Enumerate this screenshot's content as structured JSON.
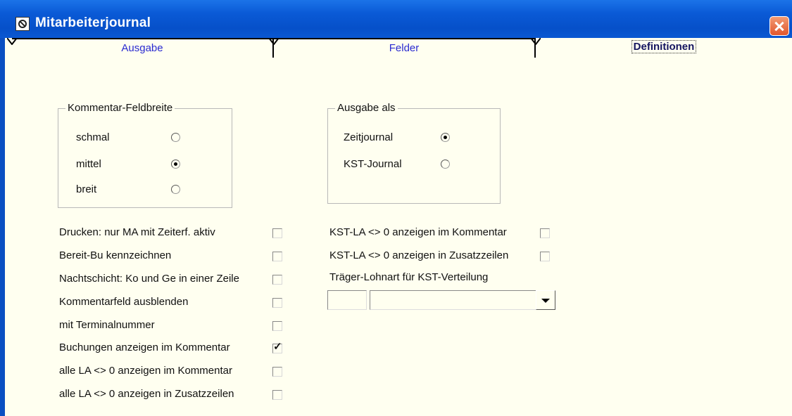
{
  "window": {
    "title": "Mitarbeiterjournal"
  },
  "tabs": [
    "Ausgabe",
    "Felder",
    "Definitionen"
  ],
  "kommentar_group": {
    "legend": "Kommentar-Feldbreite",
    "options": [
      {
        "label": "schmal",
        "selected": false
      },
      {
        "label": "mittel",
        "selected": true
      },
      {
        "label": "breit",
        "selected": false
      }
    ]
  },
  "ausgabe_group": {
    "legend": "Ausgabe als",
    "options": [
      {
        "label": "Zeitjournal",
        "selected": true
      },
      {
        "label": "KST-Journal",
        "selected": false
      }
    ]
  },
  "left_checks": [
    {
      "label": "Drucken: nur MA mit Zeiterf. aktiv",
      "checked": false
    },
    {
      "label": "Bereit-Bu kennzeichnen",
      "checked": false
    },
    {
      "label": "Nachtschicht: Ko und Ge in einer Zeile",
      "checked": false
    },
    {
      "label": "Kommentarfeld ausblenden",
      "checked": false
    },
    {
      "label": "mit Terminalnummer",
      "checked": false
    },
    {
      "label": "Buchungen anzeigen im Kommentar",
      "checked": true
    },
    {
      "label": "alle LA <> 0 anzeigen im Kommentar",
      "checked": false
    },
    {
      "label": "alle LA <> 0 anzeigen in Zusatzzeilen",
      "checked": false
    }
  ],
  "right_checks": [
    {
      "label": "KST-LA <> 0 anzeigen im Kommentar",
      "checked": false
    },
    {
      "label": "KST-LA <> 0 anzeigen in Zusatzzeilen",
      "checked": false
    }
  ],
  "traeger": {
    "label": "Träger-Lohnart für KST-Verteilung",
    "code_value": "",
    "name_value": ""
  },
  "colors": {
    "titlebar": "#0650c9",
    "background": "#fffff0",
    "tab_text": "#2a2ad0"
  }
}
